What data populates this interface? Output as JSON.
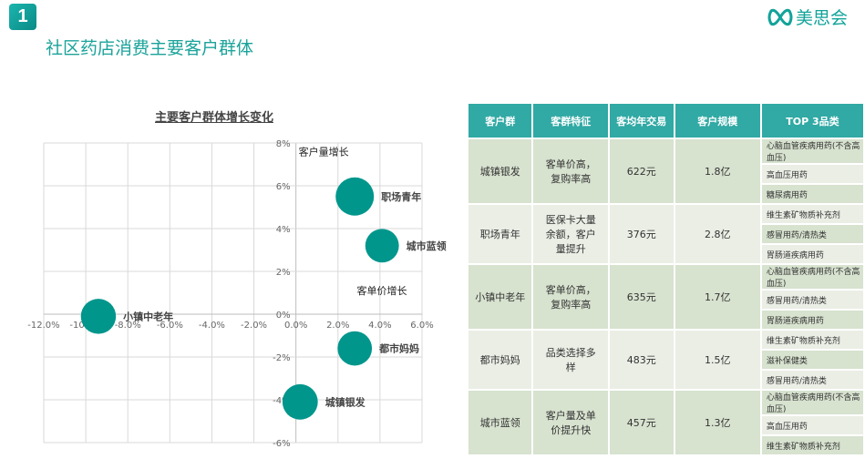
{
  "header": {
    "badge": "1",
    "title": "社区药店消费主要客户群体",
    "logo_text": "美思会"
  },
  "chart_data": {
    "type": "scatter",
    "title": "主要客户群体增长变化",
    "xlabel": "客单价增长",
    "ylabel": "客户量增长",
    "xlim": [
      -12,
      6
    ],
    "ylim": [
      -6,
      8
    ],
    "x_ticks": [
      "-12.0%",
      "-10.0%",
      "-8.0%",
      "-6.0%",
      "-4.0%",
      "-2.0%",
      "0.0%",
      "2.0%",
      "4.0%",
      "6.0%"
    ],
    "y_ticks": [
      "8%",
      "6%",
      "4%",
      "2%",
      "0%",
      "-2%",
      "-4%",
      "-6%"
    ],
    "grid": true,
    "points": [
      {
        "label": "职场青年",
        "x": 2.8,
        "y": 5.5,
        "size": 2.8
      },
      {
        "label": "城市蓝领",
        "x": 4.1,
        "y": 3.2,
        "size": 1.3
      },
      {
        "label": "小镇中老年",
        "x": -9.4,
        "y": -0.1,
        "size": 1.7
      },
      {
        "label": "都市妈妈",
        "x": 2.8,
        "y": -1.6,
        "size": 1.5
      },
      {
        "label": "城镇银发",
        "x": 0.2,
        "y": -4.1,
        "size": 1.8
      }
    ],
    "bubble_color": "#00968c"
  },
  "table": {
    "headers": [
      "客户群",
      "客群特征",
      "客均年交易",
      "客户规模",
      "TOP 3品类"
    ],
    "rows": [
      {
        "group": "城镇银发",
        "feature": "客单价高，复购率高",
        "annual": "622元",
        "scale": "1.8亿",
        "top": [
          "心脑血管疾病用药(不含高血压)",
          "高血压用药",
          "糖尿病用药"
        ]
      },
      {
        "group": "职场青年",
        "feature": "医保卡大量余额，客户量提升",
        "annual": "376元",
        "scale": "2.8亿",
        "top": [
          "维生素矿物质补充剂",
          "感冒用药/清热类",
          "胃肠道疾病用药"
        ]
      },
      {
        "group": "小镇中老年",
        "feature": "客单价高，复购率高",
        "annual": "635元",
        "scale": "1.7亿",
        "top": [
          "心脑血管疾病用药(不含高血压)",
          "感冒用药/清热类",
          "胃肠道疾病用药"
        ]
      },
      {
        "group": "都市妈妈",
        "feature": "品类选择多样",
        "annual": "483元",
        "scale": "1.5亿",
        "top": [
          "维生素矿物质补充剂",
          "滋补保健类",
          "感冒用药/清热类"
        ]
      },
      {
        "group": "城市蓝领",
        "feature": "客户量及单价提升快",
        "annual": "457元",
        "scale": "1.3亿",
        "top": [
          "心脑血管疾病用药(不含高血压)",
          "高血压用药",
          "维生素矿物质补充剂"
        ]
      }
    ]
  }
}
